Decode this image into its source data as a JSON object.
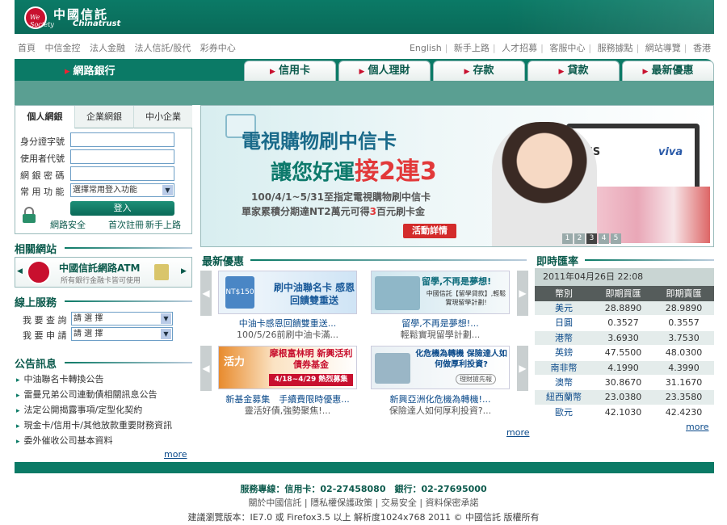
{
  "header": {
    "logo_script": "We Society",
    "brand_cn": "中國信託",
    "brand_en": "Chinatrust"
  },
  "left_links": [
    "首頁",
    "中信金控",
    "法人金融",
    "法人信託/股代",
    "彩券中心"
  ],
  "right_links": [
    "English",
    "新手上路",
    "人才招募",
    "客服中心",
    "服務據點",
    "網站導覽",
    "香港"
  ],
  "ebank_label": "網路銀行",
  "main_tabs": [
    "信用卡",
    "個人理財",
    "存款",
    "貸款",
    "最新優惠"
  ],
  "login": {
    "tabs": [
      "個人網銀",
      "企業網銀",
      "中小企業"
    ],
    "id_label": "身分證字號",
    "user_label": "使用者代號",
    "pwd_label": "網 銀 密 碼",
    "func_label": "常 用 功 能",
    "func_select": "選擇常用登入功能",
    "login_button": "登入",
    "security_link": "網路安全",
    "register_link": "首次註冊",
    "newbie_link": "新手上路"
  },
  "related": {
    "title": "相關網站",
    "atm_title": "中國信託網路ATM",
    "atm_sub": "所有銀行金融卡皆可使用"
  },
  "online": {
    "title": "線上服務",
    "query_label": "我 要 查 詢",
    "query_select": "請 選 擇",
    "apply_label": "我 要 申 請",
    "apply_select": "請 選 擇"
  },
  "notices": {
    "title": "公告訊息",
    "items": [
      "中油聯名卡轉換公告",
      "雷曼兄弟公司連動債相關訊息公告",
      "法定公開揭露事項/定型化契約",
      "現金卡/信用卡/其他放款重要財務資訊",
      "委外催收公司基本資料"
    ],
    "more": "more"
  },
  "banner": {
    "line1": "電視購物刷中信卡",
    "line2a": "讓您好運",
    "line2b": "接2連3",
    "line3": "100/4/1~5/31至指定電視購物刷中信卡",
    "line4a": "單家累積分期達NT2萬元可得",
    "line4b": "3",
    "line4c": "百元刷卡金",
    "button": "活動詳情",
    "brand1": "EHS",
    "brand2": "viva",
    "pages": [
      "1",
      "2",
      "3",
      "4",
      "5"
    ]
  },
  "promos": {
    "title": "最新優惠",
    "items": [
      {
        "img_text": "刷中油聯名卡 感恩回饋雙重送",
        "img_sub": "NT$150",
        "caption": "中油卡感恩回饋雙重送...",
        "sub": "100/5/26前刷中油卡滿..."
      },
      {
        "img_text": "留學,不再是夢想!",
        "img_sub": "中國信託【留學貸款】,輕鬆實現留學計劃!",
        "caption": "留學,不再是夢想!...",
        "sub": "輕鬆實現留學計劃..."
      },
      {
        "img_text": "摩根富林明 新興活利債券基金",
        "img_sub": "4/18~4/29 熱烈募集",
        "img_badge": "活力",
        "caption": "新基金募集　手續費限時優惠...",
        "sub": "靈活好債,強勢聚焦!..."
      },
      {
        "img_text": "化危機為轉機 保險達人如何做厚利投資?",
        "img_sub": "理財搶先報",
        "caption": "新興亞洲化危機為轉機!...",
        "sub": "保險達人如何厚利投資?..."
      }
    ],
    "more": "more"
  },
  "rates": {
    "title": "即時匯率",
    "date": "2011年04月26日 22:08",
    "headers": [
      "幣別",
      "即期買匯",
      "即期賣匯"
    ],
    "rows": [
      [
        "美元",
        "28.8890",
        "28.9890"
      ],
      [
        "日圓",
        "0.3527",
        "0.3557"
      ],
      [
        "港幣",
        "3.6930",
        "3.7530"
      ],
      [
        "英鎊",
        "47.5500",
        "48.0300"
      ],
      [
        "南非幣",
        "4.1990",
        "4.3990"
      ],
      [
        "澳幣",
        "30.8670",
        "31.1670"
      ],
      [
        "紐西蘭幣",
        "23.0380",
        "23.3580"
      ],
      [
        "歐元",
        "42.1030",
        "42.4230"
      ]
    ],
    "more": "more"
  },
  "footer": {
    "hotline": "服務專線：信用卡：02-27458080　銀行：02-27695000",
    "links": [
      "關於中國信託",
      "隱私權保護政策",
      "交易安全",
      "資料保密承諾"
    ],
    "copyright": "建議瀏覽版本：IE7.0 或 Firefox3.5 以上 解析度1024x768 2011 © 中國信託 版權所有"
  }
}
